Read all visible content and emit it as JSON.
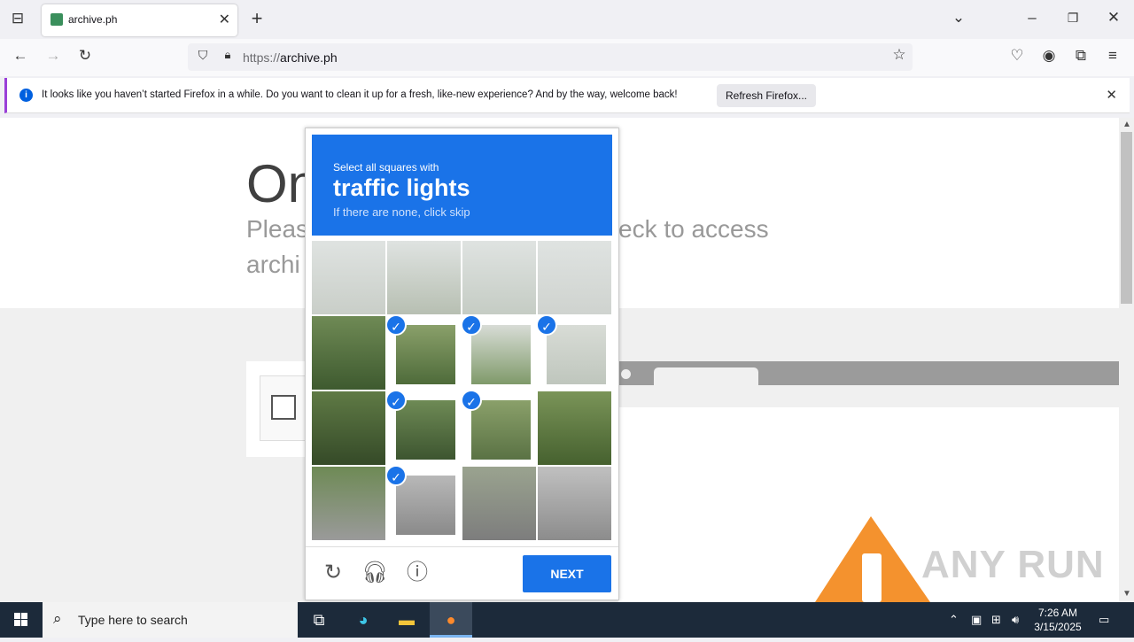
{
  "browser": {
    "tab_title": "archive.ph",
    "url_protocol": "https://",
    "url_host": "archive.ph",
    "notification": {
      "message": "It looks like you haven’t started Firefox in a while. Do you want to clean it up for a fresh, like-new experience? And by the way, welcome back!",
      "button": "Refresh Firefox..."
    }
  },
  "page": {
    "heading": "On",
    "line1": "Pleas",
    "line1_right": "eck to access",
    "line2": "archi"
  },
  "captcha": {
    "instruction": "Select all squares with",
    "target": "traffic lights",
    "hint": "If there are none, click skip",
    "next_label": "NEXT",
    "tiles": [
      {
        "selected": false
      },
      {
        "selected": false
      },
      {
        "selected": false
      },
      {
        "selected": false
      },
      {
        "selected": false
      },
      {
        "selected": true
      },
      {
        "selected": true
      },
      {
        "selected": true
      },
      {
        "selected": false
      },
      {
        "selected": true
      },
      {
        "selected": true
      },
      {
        "selected": false
      },
      {
        "selected": false
      },
      {
        "selected": true
      },
      {
        "selected": false
      },
      {
        "selected": false
      }
    ]
  },
  "watermark": "ANY RUN",
  "taskbar": {
    "search_placeholder": "Type here to search",
    "time": "7:26 AM",
    "date": "3/15/2025"
  },
  "colors": {
    "captcha_blue": "#1a73e8",
    "warning_orange": "#f4922e"
  }
}
